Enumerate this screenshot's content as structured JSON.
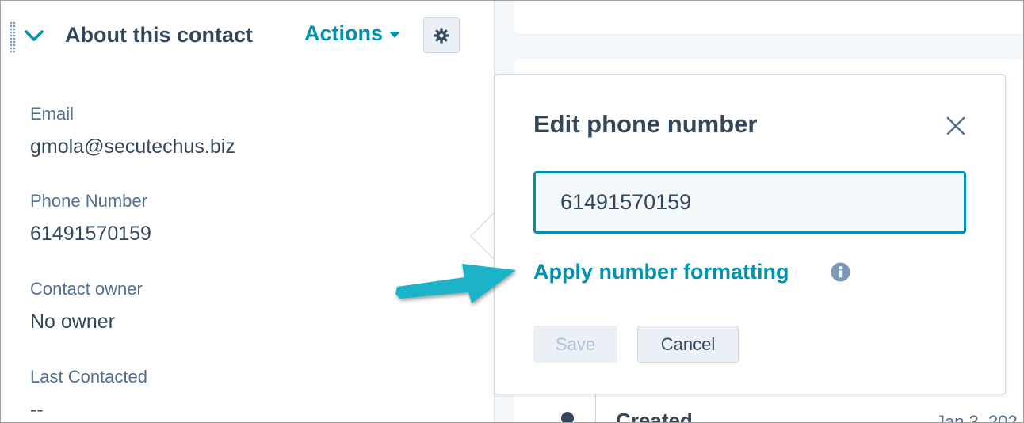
{
  "sidebar": {
    "section_title": "About this contact",
    "actions_label": "Actions",
    "properties": [
      {
        "label": "Email",
        "value": "gmola@secutechus.biz"
      },
      {
        "label": "Phone Number",
        "value": "61491570159"
      },
      {
        "label": "Contact owner",
        "value": "No owner"
      },
      {
        "label": "Last Contacted",
        "value": "--"
      }
    ]
  },
  "dialog": {
    "title": "Edit phone number",
    "phone_value": "61491570159",
    "apply_link": "Apply number formatting",
    "save_label": "Save",
    "cancel_label": "Cancel"
  },
  "timeline": {
    "title": "Created",
    "date": "Jan 3, 202"
  },
  "colors": {
    "accent": "#0091ae",
    "text": "#33475b",
    "annotation_arrow": "#1ab3c8"
  },
  "icons": [
    "drag-handle-icon",
    "chevron-down-icon",
    "gear-icon",
    "close-icon",
    "info-icon",
    "annotation-arrow-icon"
  ]
}
